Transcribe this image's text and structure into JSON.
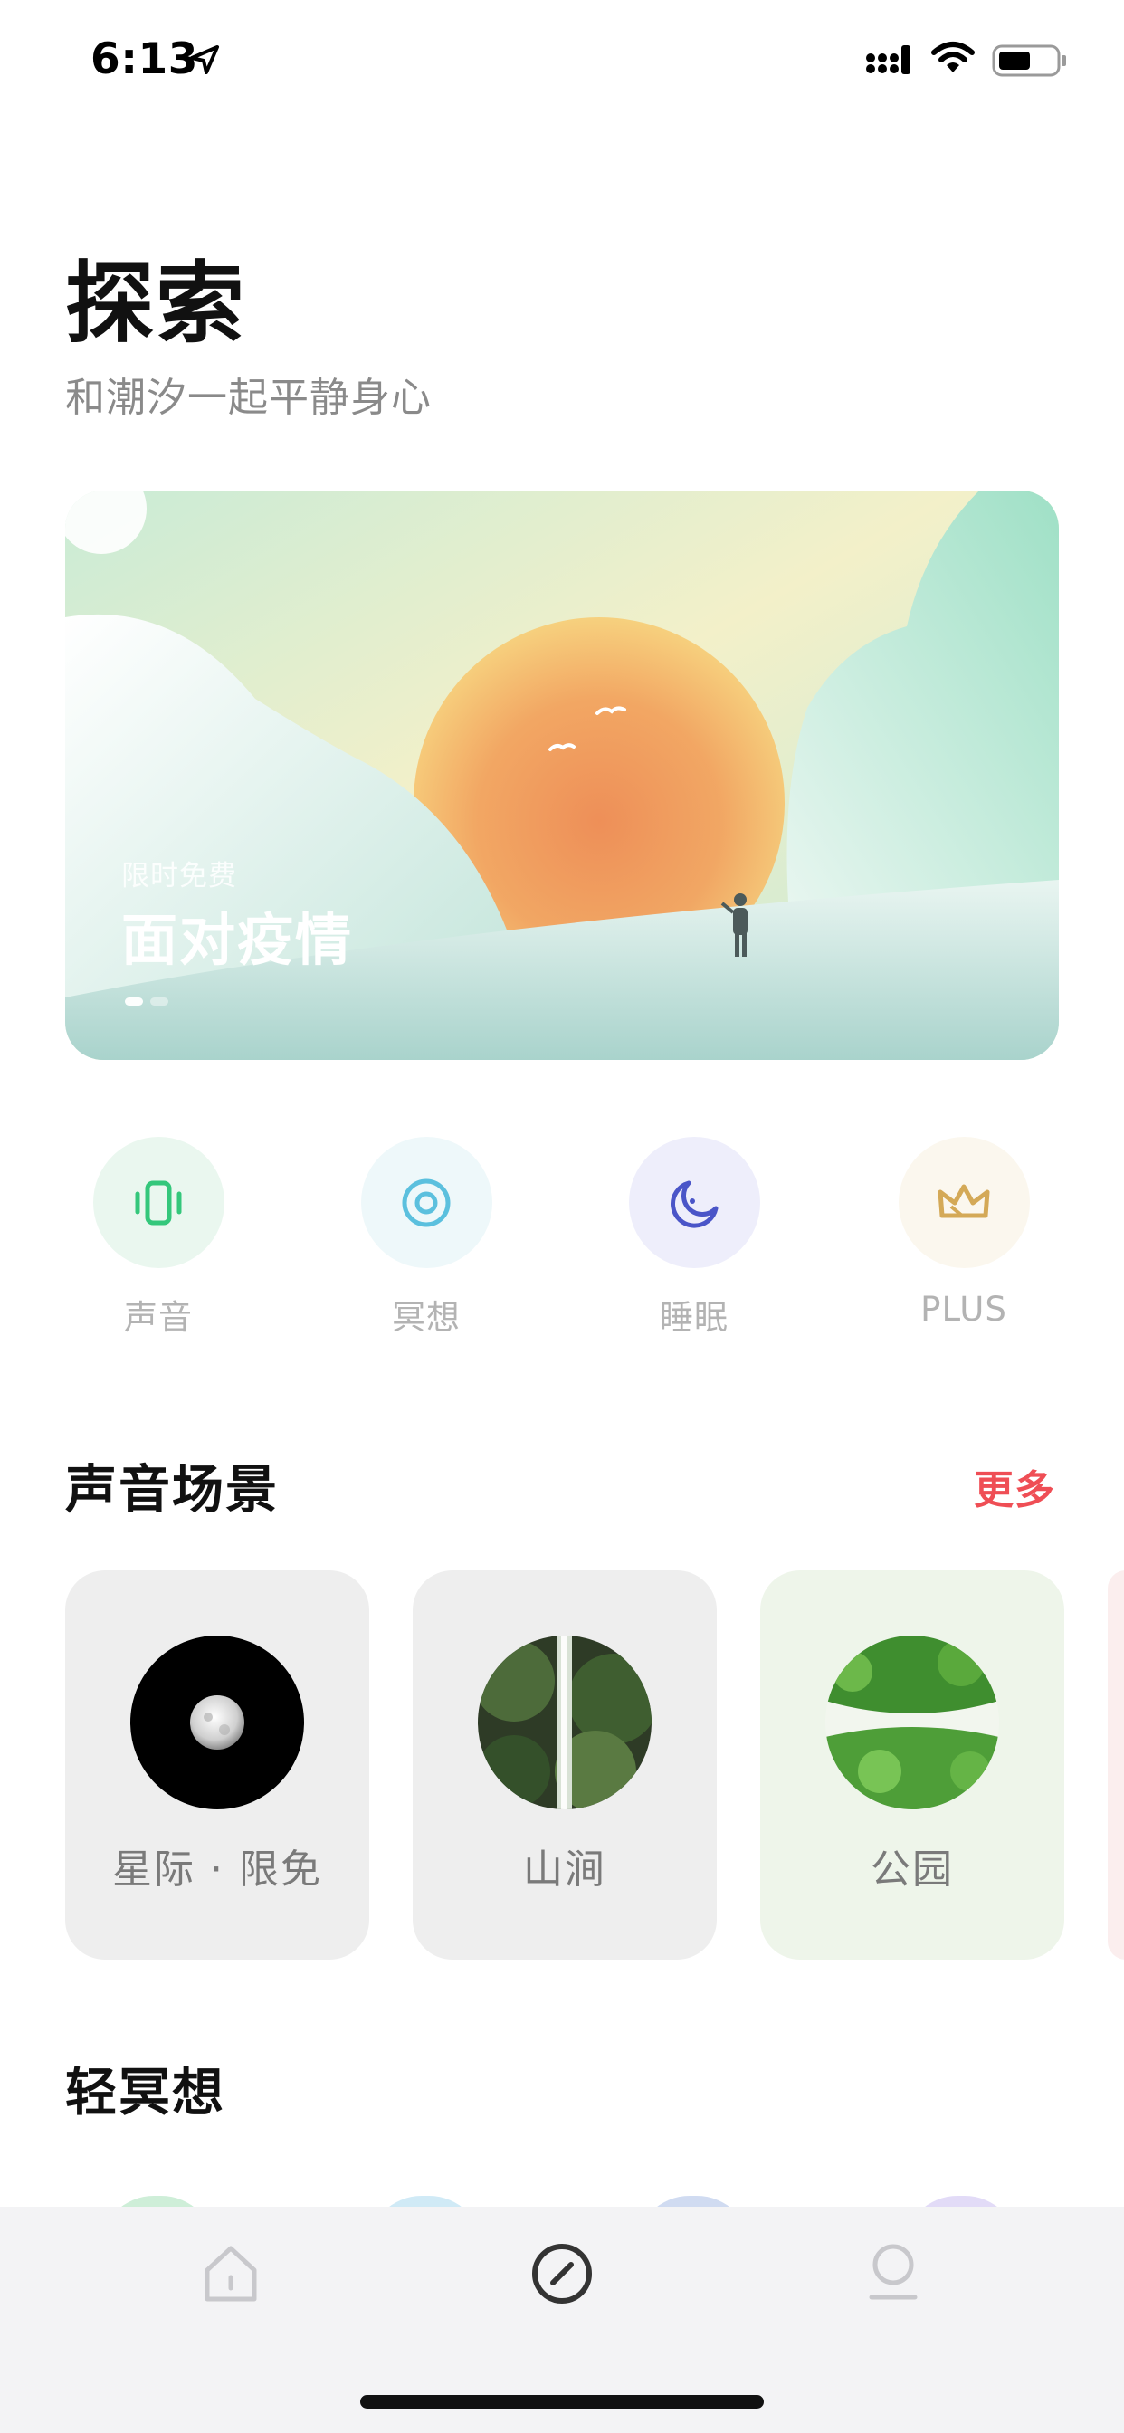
{
  "status_bar": {
    "time": "6:13",
    "icons": [
      "location-arrow-icon",
      "signal-icon",
      "wifi-icon",
      "battery-icon"
    ]
  },
  "header": {
    "title": "探索",
    "subtitle": "和潮汐一起平静身心"
  },
  "banner": {
    "tag": "限时免费",
    "title": "面对疫情",
    "pages": 2,
    "active_page": 1
  },
  "categories": [
    {
      "label": "声音",
      "icon": "vibrate-phone-icon",
      "color": "#34c77b"
    },
    {
      "label": "冥想",
      "icon": "target-ring-icon",
      "color": "#5bc0de"
    },
    {
      "label": "睡眠",
      "icon": "moon-icon",
      "color": "#4a55c8"
    },
    {
      "label": "PLUS",
      "icon": "crown-icon",
      "color": "#d4a957"
    }
  ],
  "sound_scenes": {
    "title": "声音场景",
    "more_label": "更多",
    "items": [
      {
        "label": "星际 · 限免",
        "image": "moon-image"
      },
      {
        "label": "山涧",
        "image": "waterfall-image"
      },
      {
        "label": "公园",
        "image": "leaves-image"
      }
    ]
  },
  "light_meditation": {
    "title": "轻冥想"
  },
  "tab_bar": {
    "tabs": [
      {
        "name": "home",
        "icon": "home-icon",
        "active": false
      },
      {
        "name": "explore",
        "icon": "compass-icon",
        "active": true
      },
      {
        "name": "profile",
        "icon": "profile-icon",
        "active": false
      }
    ]
  },
  "colors": {
    "accent_red": "#ef4e55",
    "tab_bar_bg": "#f3f3f5",
    "subtitle_gray": "#8a8a8a"
  }
}
